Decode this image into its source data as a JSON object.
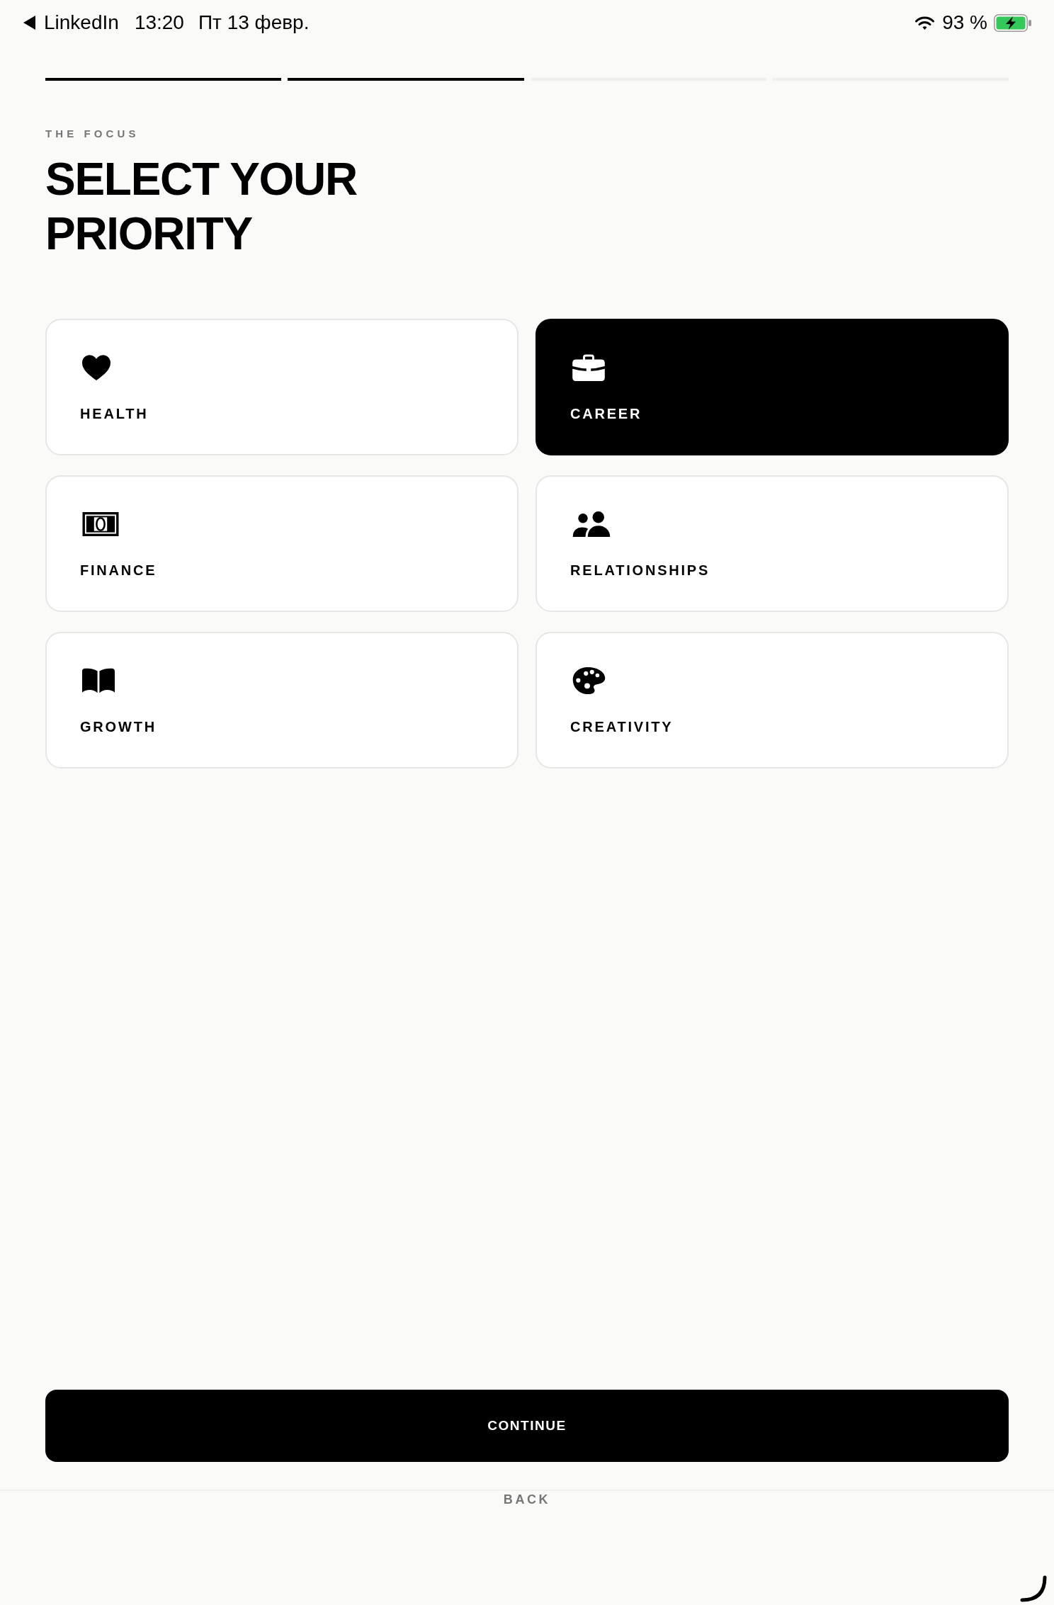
{
  "status_bar": {
    "back_app": "LinkedIn",
    "time": "13:20",
    "date": "Пт 13 февр.",
    "battery": "93 %"
  },
  "progress": {
    "steps": [
      {
        "completed": true
      },
      {
        "completed": true
      },
      {
        "completed": false
      },
      {
        "completed": false
      }
    ]
  },
  "eyebrow": "THE FOCUS",
  "title": "SELECT YOUR\nPRIORITY",
  "options": [
    {
      "label": "HEALTH",
      "selected": false
    },
    {
      "label": "CAREER",
      "selected": true
    },
    {
      "label": "FINANCE",
      "selected": false
    },
    {
      "label": "RELATIONSHIPS",
      "selected": false
    },
    {
      "label": "GROWTH",
      "selected": false
    },
    {
      "label": "CREATIVITY",
      "selected": false
    }
  ],
  "continue_button": "CONTINUE",
  "back_button": "BACK"
}
